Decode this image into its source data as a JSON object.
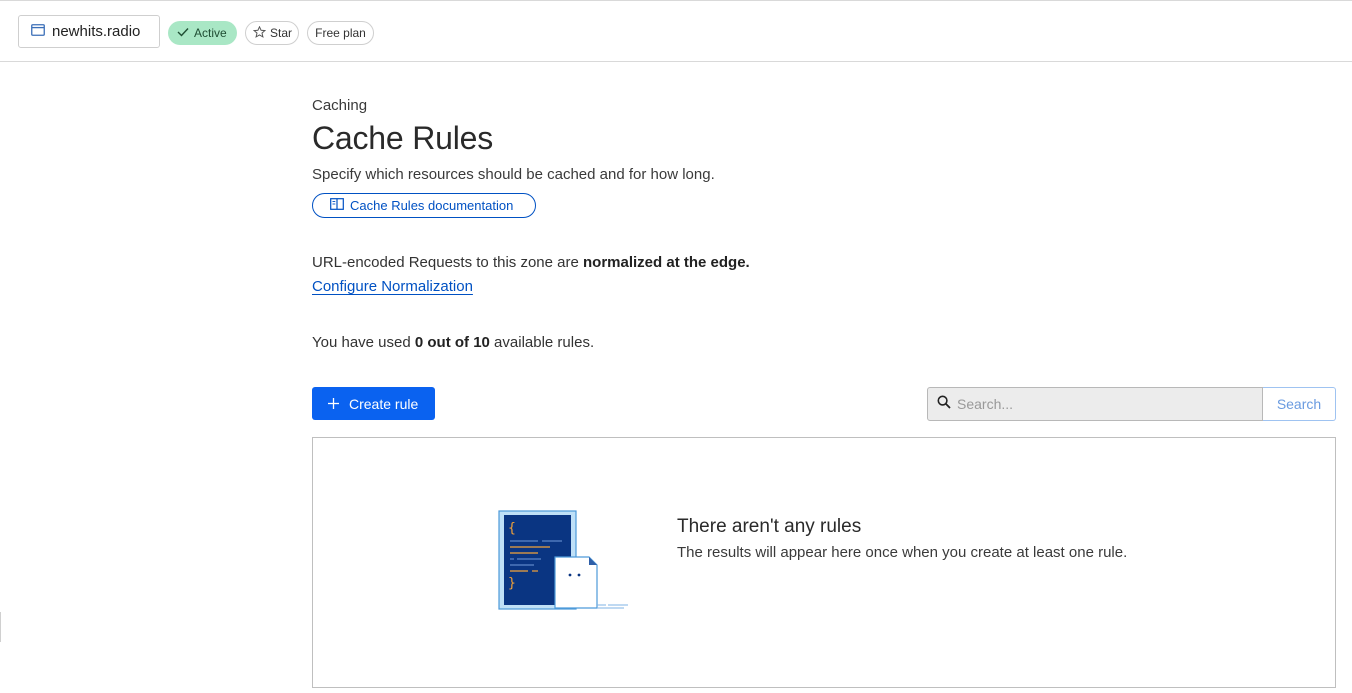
{
  "header": {
    "zone_name": "newhits.radio",
    "status_label": "Active",
    "star_label": "Star",
    "plan_label": "Free plan"
  },
  "page": {
    "breadcrumb": "Caching",
    "title": "Cache Rules",
    "description": "Specify which resources should be cached and for how long.",
    "doc_link_label": "Cache Rules documentation"
  },
  "normalization": {
    "text_prefix": "URL-encoded Requests to this zone are ",
    "text_bold": "normalized at the edge.",
    "link_label": "Configure Normalization"
  },
  "usage": {
    "text_prefix": "You have used ",
    "text_bold": "0 out of 10",
    "text_suffix": " available rules."
  },
  "toolbar": {
    "create_label": "Create rule",
    "search_placeholder": "Search...",
    "search_button_label": "Search"
  },
  "empty_state": {
    "title": "There aren't any rules",
    "subtitle": "The results will appear here once when you create at least one rule."
  },
  "colors": {
    "accent": "#0051c3",
    "primary_button": "#0a62f0",
    "active_badge": "#a9e7c5"
  }
}
